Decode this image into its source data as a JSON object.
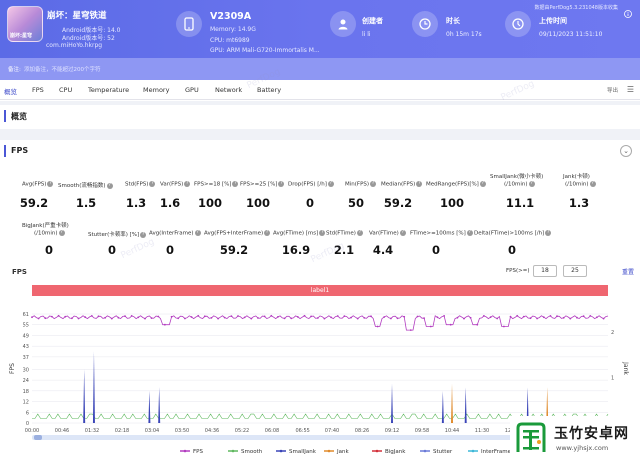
{
  "header": {
    "app_icon_text": "崩坏:星穹",
    "app_title": "崩坏：星穹铁道",
    "android_version": "Android版本号: 14.0",
    "android_api": "Android版本号: 52",
    "package": "com.miHoYo.hkrpg",
    "device_name": "V2309A",
    "device_memory": "Memory: 14.9G",
    "device_cpu": "CPU: mt6989",
    "device_gpu": "GPU: ARM Mali-G720-Immortalis M...",
    "creator_label": "创建者",
    "creator_value": "li li",
    "duration_label": "时长",
    "duration_value": "0h 15m 17s",
    "upload_label": "上传时间",
    "upload_value": "09/11/2023 11:51:10",
    "top_right_note": "数据由PerfDog5.3.231048版本收集"
  },
  "note": {
    "label": "备注:",
    "placeholder": "添加备注，不能超过200个字符"
  },
  "tabs": {
    "items": [
      "概览",
      "FPS",
      "CPU",
      "Temperature",
      "Memory",
      "GPU",
      "Network",
      "Battery"
    ],
    "export_label": "导出",
    "menu_icon": "hamburger-icon"
  },
  "sections": {
    "overview": "概览",
    "fps": "FPS"
  },
  "metrics": {
    "row1": [
      {
        "label": "Avg(FPS)",
        "value": "59.2"
      },
      {
        "label": "Smooth(流畅指数)",
        "value": "1.5"
      },
      {
        "label": "Std(FPS)",
        "value": "1.3"
      },
      {
        "label": "Var(FPS)",
        "value": "1.6"
      },
      {
        "label": "FPS>=18 [%]",
        "value": "100"
      },
      {
        "label": "FPS>=25 [%]",
        "value": "100"
      },
      {
        "label": "Drop(FPS) [/h]",
        "value": "0"
      },
      {
        "label": "Min(FPS)",
        "value": "50"
      },
      {
        "label": "Median(FPS)",
        "value": "59.2"
      },
      {
        "label": "MedRange(FPS)[%]",
        "value": "100"
      },
      {
        "label": "SmallJank(微小卡顿)",
        "label2": "(/10min)",
        "value": "11.1"
      },
      {
        "label": "Jank(卡顿)",
        "label2": "(/10min)",
        "value": "1.3"
      }
    ],
    "row2": [
      {
        "label": "BigJank(严重卡顿)",
        "label2": "(/10min)",
        "value": "0"
      },
      {
        "label": "Stutter(卡顿率) [%]",
        "value": "0"
      },
      {
        "label": "Avg(InterFrame)",
        "value": "0"
      },
      {
        "label": "Avg(FPS+InterFrame)",
        "value": "59.2"
      },
      {
        "label": "Avg(FTime) [ms]",
        "value": "16.9"
      },
      {
        "label": "Std(FTime)",
        "value": "2.1"
      },
      {
        "label": "Var(FTime)",
        "value": "4.4"
      },
      {
        "label": "FTime>=100ms [%]",
        "value": "0"
      },
      {
        "label": "Delta(FTime)>100ms [/h]",
        "value": "0"
      }
    ]
  },
  "chart_controls": {
    "title": "FPS",
    "threshold_label": "FPS(>=)",
    "threshold_1": "18",
    "threshold_2": "25",
    "reset_label": "重置",
    "label_bar": "label1"
  },
  "chart_data": {
    "type": "line",
    "ylabel": "FPS",
    "y2label": "Jank",
    "yticks": [
      "0",
      "6",
      "12",
      "18",
      "24",
      "30",
      "37",
      "43",
      "49",
      "55",
      "61"
    ],
    "y2ticks": [
      "0",
      "1",
      "2"
    ],
    "xticks": [
      "00:00",
      "00:46",
      "01:32",
      "02:18",
      "03:04",
      "03:50",
      "04:36",
      "05:22",
      "06:08",
      "06:55",
      "07:40",
      "08:26",
      "09:12",
      "09:58",
      "10:44",
      "11:30",
      "12:16"
    ],
    "fps_summary": {
      "avg": 59.2,
      "min": 50,
      "max": 61
    },
    "fps_dips": [
      {
        "t": "03:25",
        "fps": 55
      },
      {
        "t": "08:50",
        "fps": 54
      },
      {
        "t": "09:40",
        "fps": 52
      },
      {
        "t": "10:10",
        "fps": 54
      },
      {
        "t": "10:40",
        "fps": 55
      },
      {
        "t": "11:20",
        "fps": 55
      },
      {
        "t": "12:05",
        "fps": 54
      }
    ],
    "small_jank_spikes": [
      {
        "t": "01:20",
        "h": 30
      },
      {
        "t": "01:35",
        "h": 40
      },
      {
        "t": "03:00",
        "h": 18
      },
      {
        "t": "03:15",
        "h": 20
      },
      {
        "t": "09:12",
        "h": 22
      },
      {
        "t": "10:30",
        "h": 18
      },
      {
        "t": "11:05",
        "h": 20
      },
      {
        "t": "12:40",
        "h": 20
      }
    ],
    "jank_spikes": [
      {
        "t": "10:44",
        "h": 22
      },
      {
        "t": "13:10",
        "h": 20
      }
    ],
    "legend": [
      "FPS",
      "Smooth",
      "SmallJank",
      "Jank",
      "BigJank",
      "Stutter",
      "InterFrame"
    ],
    "colors": {
      "FPS": "#b23cc0",
      "Smooth": "#5fb85f",
      "SmallJank": "#3a45b8",
      "Jank": "#e08a2a",
      "BigJank": "#d2303a",
      "Stutter": "#6a7ad8",
      "InterFrame": "#3db8d8"
    }
  },
  "watermark_text": "PerfDog",
  "logo": {
    "cn": "玉竹安卓网",
    "url": "www.yjhsjx.com"
  }
}
